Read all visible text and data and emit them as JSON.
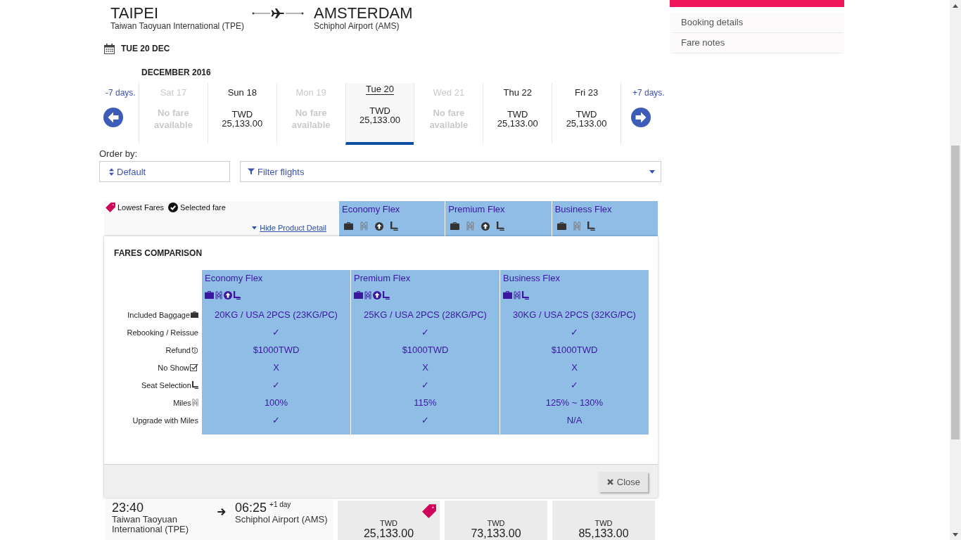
{
  "route": {
    "origin": {
      "city": "TAIPEI",
      "airport": "Taiwan Taoyuan International (TPE)"
    },
    "destination": {
      "city": "AMSTERDAM",
      "airport": "Schiphol Airport (AMS)"
    }
  },
  "travel_date": "TUE 20 DEC",
  "date_selector": {
    "month": "DECEMBER 2016",
    "previous": "-7 days.",
    "next": "+7 days.",
    "days": [
      {
        "label": "Sat 17",
        "selected": false,
        "available": false,
        "note": "No fare available"
      },
      {
        "label": "Sun 18",
        "selected": false,
        "available": true,
        "currency": "TWD",
        "amount": "25,133.00"
      },
      {
        "label": "Mon 19",
        "selected": false,
        "available": false,
        "note": "No fare available"
      },
      {
        "label": "Tue 20",
        "selected": true,
        "available": true,
        "currency": "TWD",
        "amount": "25,133.00"
      },
      {
        "label": "Wed 21",
        "selected": false,
        "available": false,
        "note": "No fare available"
      },
      {
        "label": "Thu 22",
        "selected": false,
        "available": true,
        "currency": "TWD",
        "amount": "25,133.00"
      },
      {
        "label": "Fri 23",
        "selected": false,
        "available": true,
        "currency": "TWD",
        "amount": "25,133.00"
      }
    ]
  },
  "order_by": {
    "label": "Order by:",
    "value": "Default"
  },
  "filter": {
    "label": "Filter flights"
  },
  "fare_header": {
    "legend": [
      {
        "kind": "lowest",
        "label": "Lowest Fares"
      },
      {
        "kind": "selected",
        "label": "Selected fare"
      }
    ],
    "toggle": "Hide Product Detail",
    "families": [
      {
        "name": "Economy Flex",
        "upgradable": true
      },
      {
        "name": "Premium Flex",
        "upgradable": true
      },
      {
        "name": "Business Flex",
        "upgradable": false
      }
    ]
  },
  "comparison": {
    "title": "FARES COMPARISON",
    "columns": [
      {
        "name": "Economy Flex",
        "upgradable": true
      },
      {
        "name": "Premium Flex",
        "upgradable": true
      },
      {
        "name": "Business Flex",
        "upgradable": false
      }
    ],
    "rows": [
      {
        "kind": "baggage",
        "label": "Included Baggage",
        "values": [
          "20KG / USA 2PCS (23KG/PC)",
          "25KG / USA 2PCS (28KG/PC)",
          "30KG / USA 2PCS (32KG/PC)"
        ]
      },
      {
        "kind": "rebooking",
        "label": "Rebooking / Reissue",
        "values": [
          "✓",
          "✓",
          "✓"
        ]
      },
      {
        "kind": "refund",
        "label": "Refund",
        "values": [
          "$1000TWD",
          "$1000TWD",
          "$1000TWD"
        ]
      },
      {
        "kind": "no_show",
        "label": "No Show",
        "values": [
          "X",
          "X",
          "X"
        ]
      },
      {
        "kind": "seat",
        "label": "Seat Selection",
        "values": [
          "✓",
          "✓",
          "✓"
        ]
      },
      {
        "kind": "miles",
        "label": "Miles",
        "values": [
          "100%",
          "115%",
          "125% ~ 130%"
        ]
      },
      {
        "kind": "upgrade",
        "label": "Upgrade with Miles",
        "values": [
          "✓",
          "✓",
          "N/A"
        ]
      }
    ],
    "close": "Close"
  },
  "flight": {
    "departure": {
      "time": "23:40",
      "airport": "Taiwan Taoyuan International (TPE)"
    },
    "arrival": {
      "time": "06:25",
      "day_offset": "+1 day",
      "airport": "Schiphol Airport (AMS)"
    },
    "fares": [
      {
        "currency": "TWD",
        "amount": "25,133.00",
        "lowest": true
      },
      {
        "currency": "TWD",
        "amount": "73,133.00",
        "lowest": false
      },
      {
        "currency": "TWD",
        "amount": "85,133.00",
        "lowest": false
      }
    ]
  },
  "sidebar": {
    "items": [
      {
        "label": "Booking details"
      },
      {
        "label": "Fare notes"
      }
    ]
  }
}
